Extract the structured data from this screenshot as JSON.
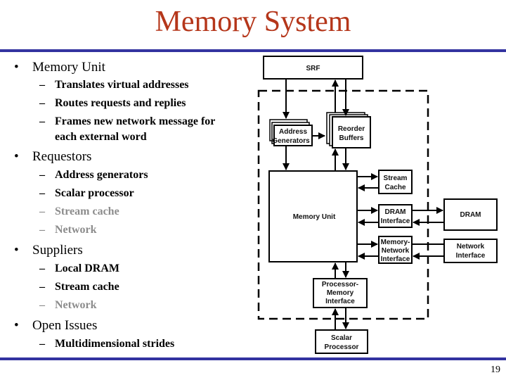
{
  "title": "Memory System",
  "page_number": "19",
  "colors": {
    "title": "#b5361a",
    "rule": "#3333a0",
    "dimmed_text": "#8c8c8c"
  },
  "outline": [
    {
      "label": "Memory Unit",
      "items": [
        {
          "text": "Translates virtual addresses",
          "dimmed": false
        },
        {
          "text": "Routes requests and replies",
          "dimmed": false
        },
        {
          "text": "Frames new network message for",
          "cont": "each external word",
          "dimmed": false
        }
      ]
    },
    {
      "label": "Requestors",
      "items": [
        {
          "text": "Address generators",
          "dimmed": false
        },
        {
          "text": "Scalar processor",
          "dimmed": false
        },
        {
          "text": "Stream cache",
          "dimmed": true
        },
        {
          "text": "Network",
          "dimmed": true
        }
      ]
    },
    {
      "label": "Suppliers",
      "items": [
        {
          "text": "Local DRAM",
          "dimmed": false
        },
        {
          "text": "Stream cache",
          "dimmed": false
        },
        {
          "text": "Network",
          "dimmed": true
        }
      ]
    },
    {
      "label": "Open Issues",
      "items": [
        {
          "text": "Multidimensional strides",
          "dimmed": false
        }
      ]
    }
  ],
  "symbols": {
    "bullet": "•",
    "dash": "–"
  },
  "diagram": {
    "srf": "SRF",
    "address_generators": [
      "Address",
      "Generators"
    ],
    "reorder_buffers": [
      "Reorder",
      "Buffers"
    ],
    "memory_unit": "Memory Unit",
    "stream_cache": [
      "Stream",
      "Cache"
    ],
    "dram_interface": [
      "DRAM",
      "Interface"
    ],
    "memory_network_interface": [
      "Memory-",
      "Network",
      "Interface"
    ],
    "dram": "DRAM",
    "network_interface": [
      "Network",
      "Interface"
    ],
    "processor_memory_interface": [
      "Processor-",
      "Memory",
      "Interface"
    ],
    "scalar_processor": [
      "Scalar",
      "Processor"
    ]
  }
}
